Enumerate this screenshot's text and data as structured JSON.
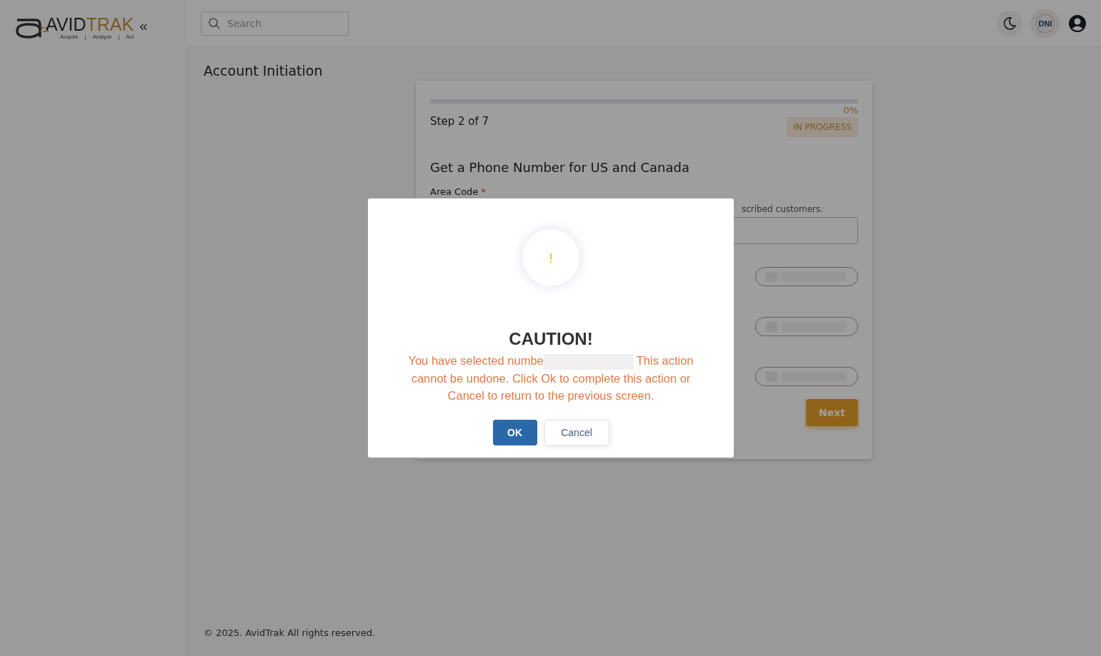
{
  "logo": {
    "word_dark": "AVID",
    "word_accent": "TRAK",
    "tagline": [
      "Acquire",
      "|",
      "Analyze",
      "|",
      "Act"
    ]
  },
  "sidebar": {
    "collapse": "«"
  },
  "header": {
    "search": {
      "placeholder": "Search"
    },
    "badge": "DNI"
  },
  "page": {
    "title": "Account Initiation"
  },
  "card": {
    "progress": {
      "level": 0,
      "reading": "0%"
    },
    "step": "Step 2 of 7",
    "status": "IN PROGRESS",
    "heading": "Get a Phone Number for US and Canada",
    "field_label": "Area Code",
    "required": "*",
    "hint": "scribed customers.",
    "number_options": [
      {
        "kind": "redacted"
      },
      {
        "kind": "redacted"
      },
      {
        "kind": "redacted"
      }
    ],
    "next_button": "Next"
  },
  "footer": "© 2025. AvidTrak All rights reserved.",
  "dialog": {
    "icon": "!",
    "title": "CAUTION!",
    "message_before": "You have selected numbe",
    "message_after": "This action cannot be undone. Click Ok to complete this action or Cancel to return to the previous screen.",
    "buttons": [
      {
        "label": "OK",
        "kind": "primary"
      },
      {
        "label": "Cancel",
        "kind": "secondary"
      }
    ]
  }
}
